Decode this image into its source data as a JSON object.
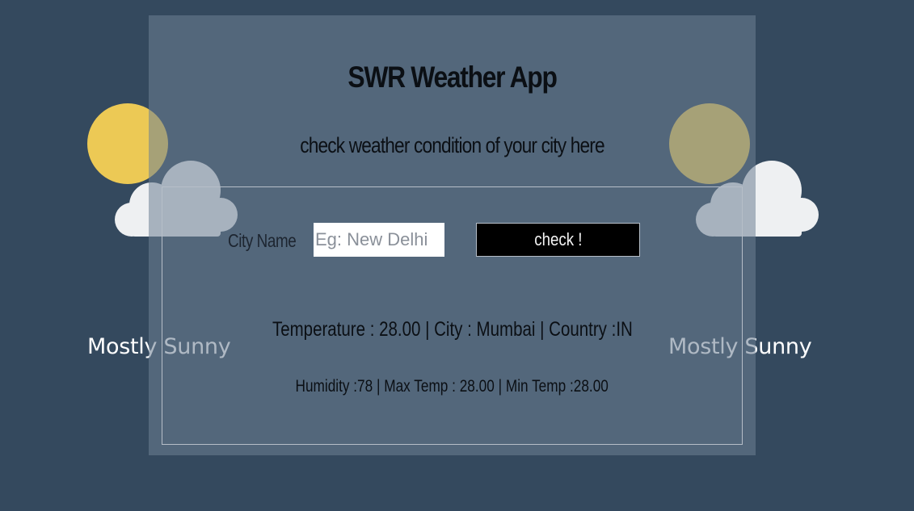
{
  "app": {
    "title": "SWR Weather App",
    "subtitle": "check weather condition of your city here"
  },
  "form": {
    "city_label": "City Name",
    "city_placeholder": "Eg: New Delhi",
    "city_value": "",
    "check_label": "check !"
  },
  "result": {
    "main": "Temperature : 28.00 | City : Mumbai | Country :IN",
    "sub": "Humidity :78 | Max Temp : 28.00 | Min Temp :28.00"
  },
  "widgets": {
    "left": {
      "icon": "partly-sunny-icon",
      "label": "Mostly Sunny"
    },
    "right": {
      "icon": "partly-sunny-icon",
      "label": "Mostly Sunny"
    }
  },
  "colors": {
    "background": "#34495e",
    "sun": "#f7d154",
    "cloud": "#f4f6f7",
    "button": "#000000"
  }
}
